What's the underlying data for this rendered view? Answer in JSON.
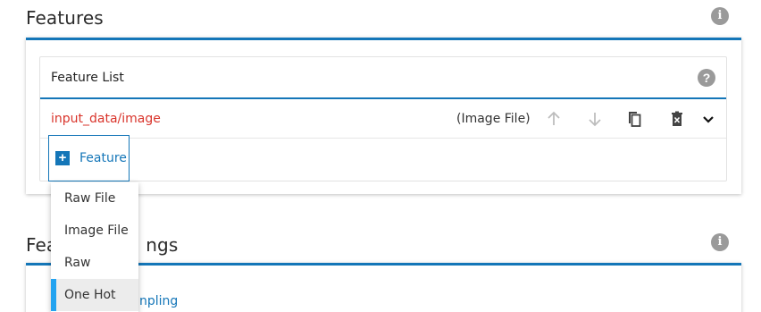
{
  "features_section": {
    "title": "Features",
    "info_icon": "i"
  },
  "feature_list": {
    "title": "Feature List",
    "help_icon": "?",
    "rows": [
      {
        "name": "input_data/image",
        "type": "(Image File)"
      }
    ],
    "add_button_label": "Feature"
  },
  "dropdown": {
    "items": [
      {
        "label": "Raw File"
      },
      {
        "label": "Image File"
      },
      {
        "label": "Raw"
      },
      {
        "label": "One Hot"
      }
    ],
    "active_index": 3
  },
  "section2": {
    "title_visible": "Fea                ngs",
    "title_left": "Fea",
    "title_right": "ngs",
    "link_fragment": "npling",
    "info_icon": "i"
  },
  "colors": {
    "accent": "#1476b8",
    "feature_name": "#d9342b",
    "active_marker": "#23a3f0"
  }
}
